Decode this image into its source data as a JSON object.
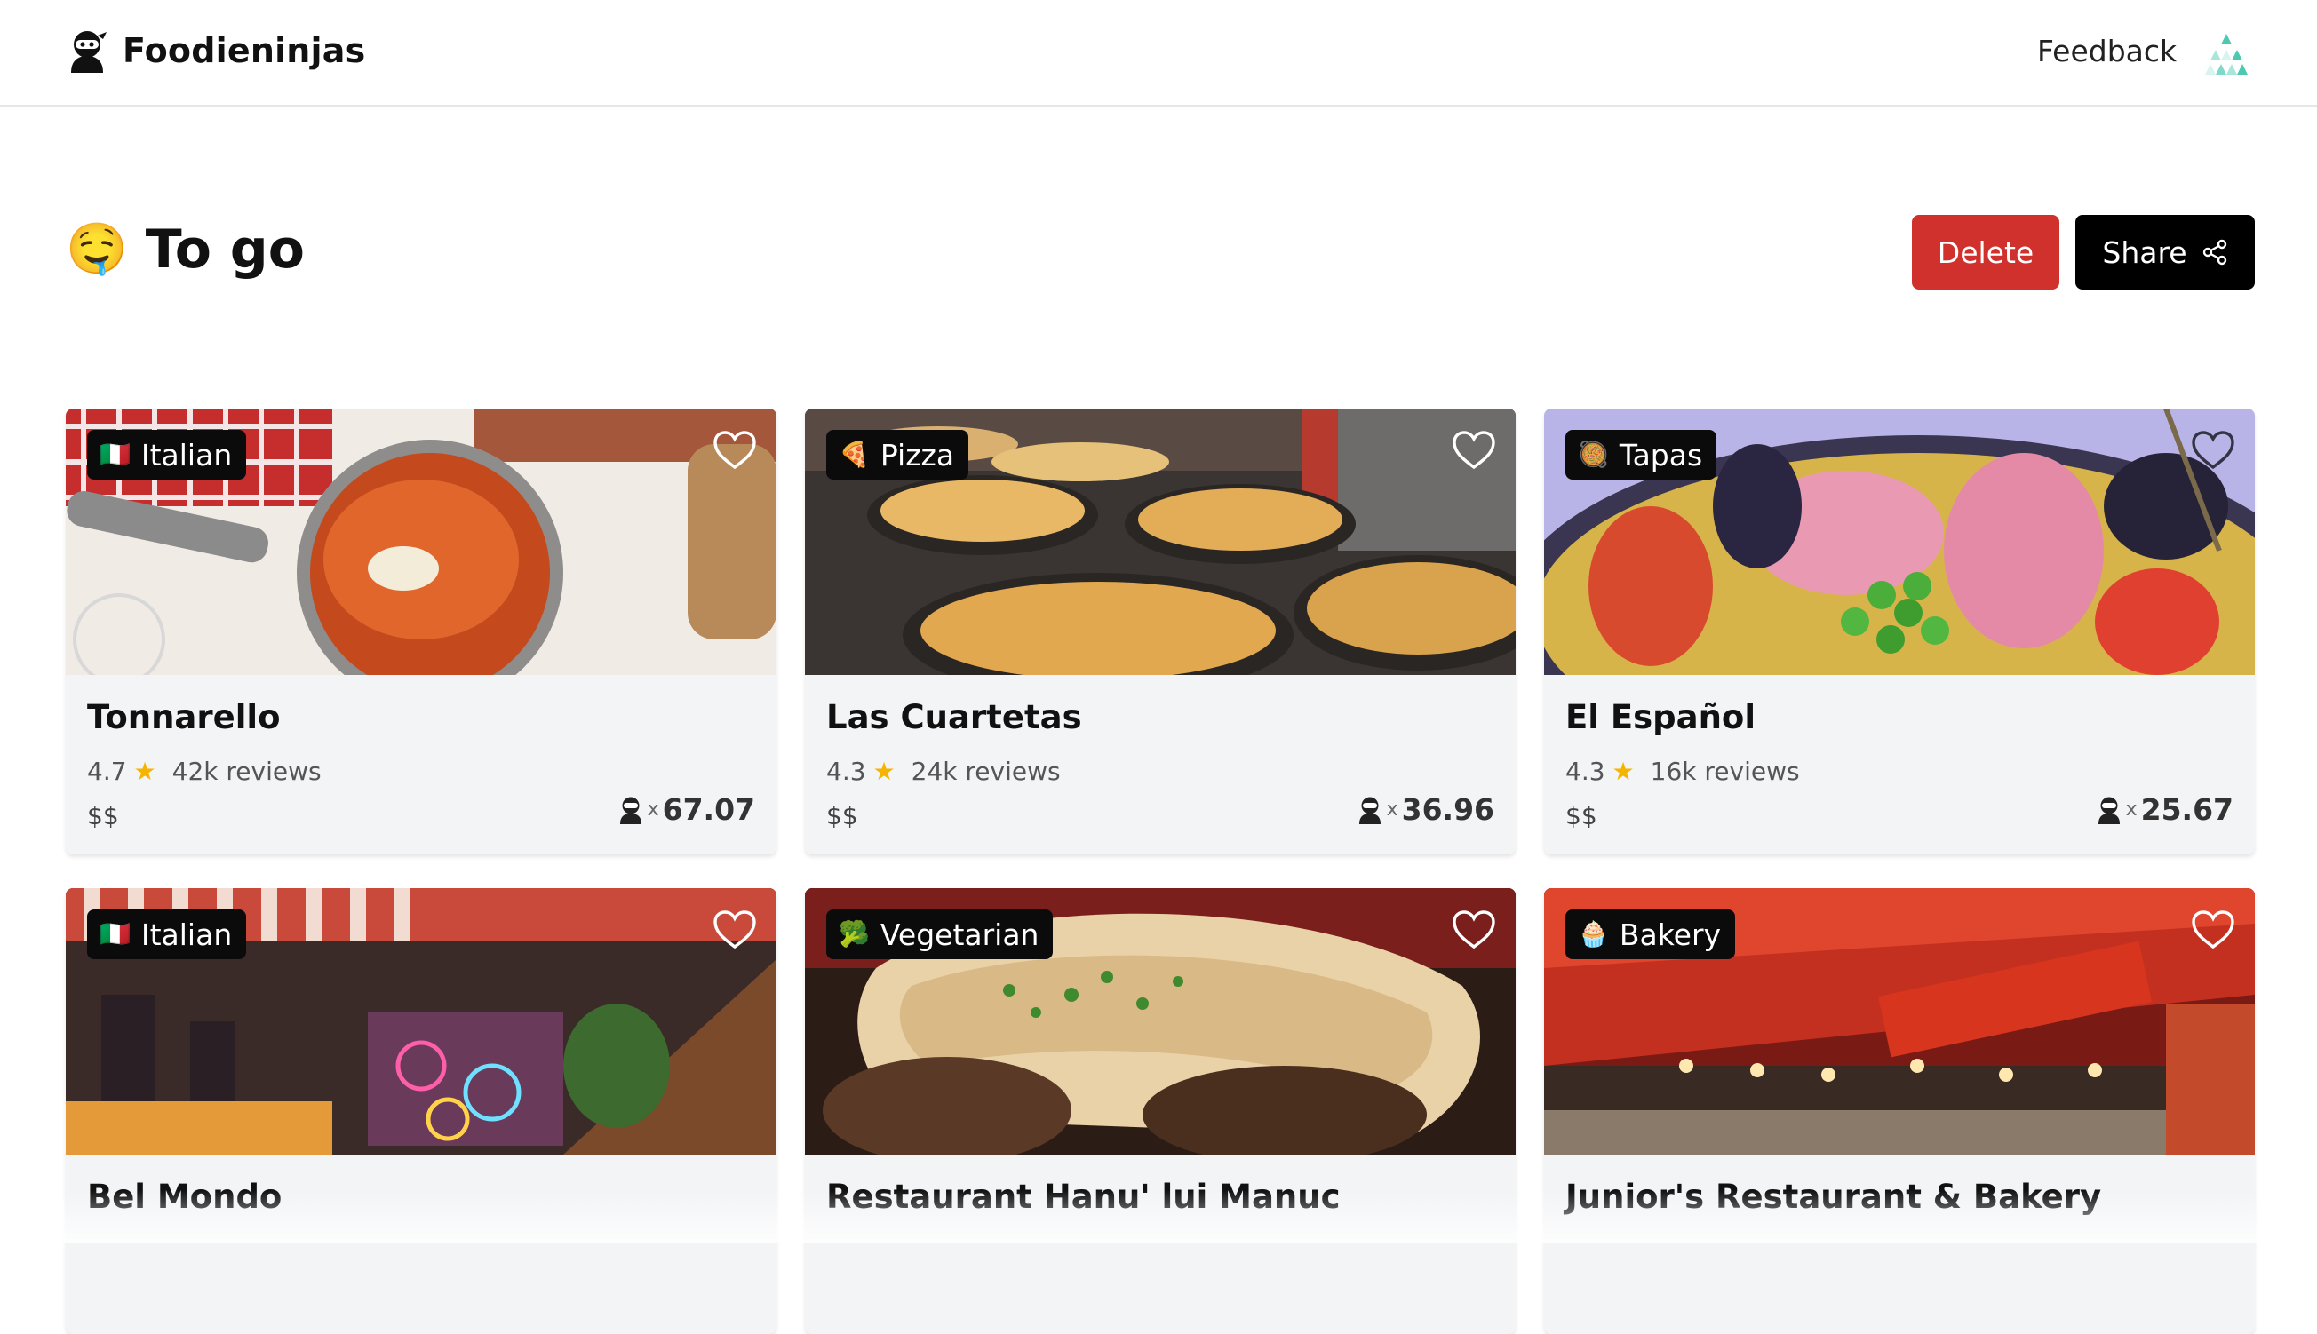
{
  "app": {
    "brand_name": "Foodieninjas",
    "feedback_label": "Feedback"
  },
  "page": {
    "emoji": "🤤",
    "title": "To go",
    "delete_label": "Delete",
    "share_label": "Share"
  },
  "score_prefix": "x",
  "restaurants": [
    {
      "tag": "Italian",
      "tag_emoji": "🇮🇹",
      "name": "Tonnarello",
      "rating": "4.7",
      "reviews": "42k reviews",
      "price": "$$",
      "score": "67.07"
    },
    {
      "tag": "Pizza",
      "tag_emoji": "🍕",
      "name": "Las Cuartetas",
      "rating": "4.3",
      "reviews": "24k reviews",
      "price": "$$",
      "score": "36.96"
    },
    {
      "tag": "Tapas",
      "tag_emoji": "🥘",
      "name": "El Español",
      "rating": "4.3",
      "reviews": "16k reviews",
      "price": "$$",
      "score": "25.67"
    },
    {
      "tag": "Italian",
      "tag_emoji": "🇮🇹",
      "name": "Bel Mondo"
    },
    {
      "tag": "Vegetarian",
      "tag_emoji": "🥦",
      "name": "Restaurant Hanu' lui Manuc"
    },
    {
      "tag": "Bakery",
      "tag_emoji": "🧁",
      "name": "Junior's Restaurant & Bakery"
    }
  ],
  "colors": {
    "delete": "#d0312d",
    "share": "#000000",
    "card_bg": "#f3f4f6",
    "star": "#f4b400"
  }
}
